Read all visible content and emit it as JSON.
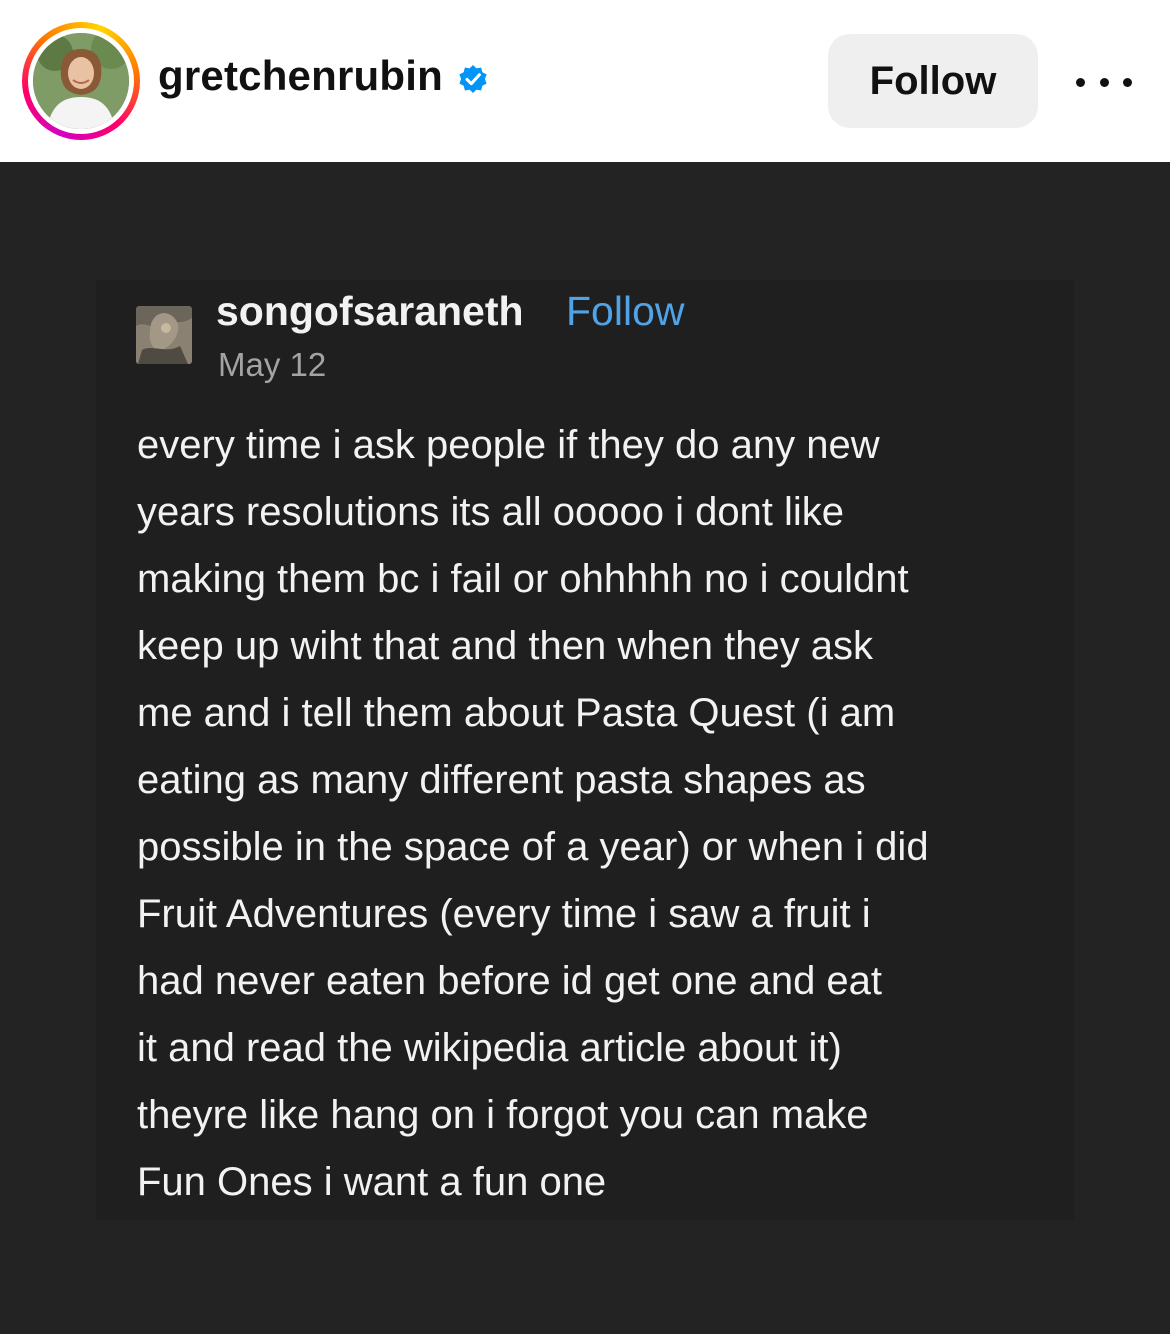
{
  "header": {
    "username": "gretchenrubin",
    "follow_label": "Follow",
    "verified_icon": "verified-badge-icon",
    "more_icon": "more-options-icon",
    "verified_color": "#0095f6"
  },
  "post": {
    "author": "songofsaraneth",
    "follow_label": "Follow",
    "date": "May 12",
    "accent_color": "#4fa3e6",
    "lines": [
      "every time i ask people if they do any new",
      "years resolutions its all ooooo i dont like",
      "making them bc i fail or ohhhhh no i couldnt",
      "keep up wiht that and then when they ask",
      "me and i tell them about Pasta Quest (i am",
      "eating as many different pasta shapes as",
      "possible in the space of a year) or when i did",
      "Fruit Adventures (every time i saw a fruit i",
      "had never eaten before id get one and eat",
      "it and read the wikipedia article about it)",
      "theyre like hang on i forgot you can make",
      "Fun Ones i want a fun one"
    ]
  }
}
